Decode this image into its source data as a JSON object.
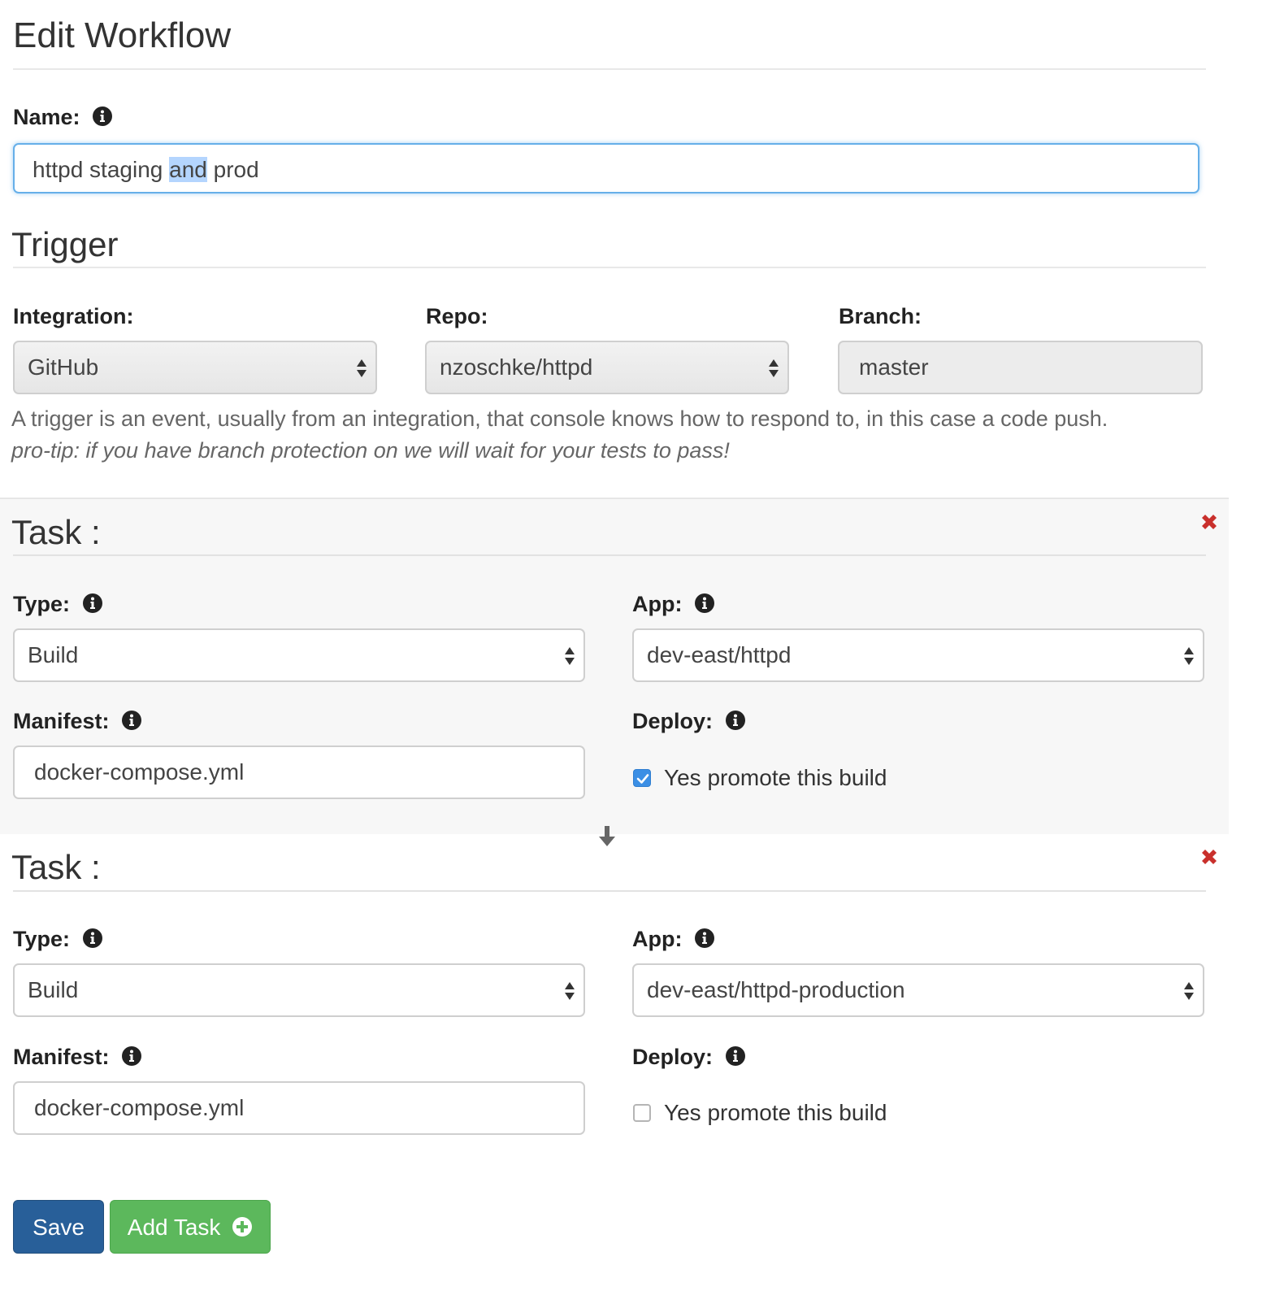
{
  "page": {
    "title": "Edit Workflow"
  },
  "name_field": {
    "label": "Name:",
    "value_before": "httpd staging ",
    "value_selected": "and",
    "value_after": " prod"
  },
  "trigger": {
    "heading": "Trigger",
    "integration": {
      "label": "Integration:",
      "value": "GitHub"
    },
    "repo": {
      "label": "Repo:",
      "value": "nzoschke/httpd"
    },
    "branch": {
      "label": "Branch:",
      "value": "master"
    },
    "help_text": "A trigger is an event, usually from an integration, that console knows how to respond to, in this case a code push.",
    "pro_tip": "pro-tip: if you have branch protection on we will wait for your tests to pass!"
  },
  "tasks": [
    {
      "heading": "Task :",
      "type": {
        "label": "Type:",
        "value": "Build"
      },
      "app": {
        "label": "App:",
        "value": "dev-east/httpd"
      },
      "manifest": {
        "label": "Manifest:",
        "value": "docker-compose.yml"
      },
      "deploy": {
        "label": "Deploy:",
        "checkbox_label": "Yes promote this build",
        "checked": true
      }
    },
    {
      "heading": "Task :",
      "type": {
        "label": "Type:",
        "value": "Build"
      },
      "app": {
        "label": "App:",
        "value": "dev-east/httpd-production"
      },
      "manifest": {
        "label": "Manifest:",
        "value": "docker-compose.yml"
      },
      "deploy": {
        "label": "Deploy:",
        "checkbox_label": "Yes promote this build",
        "checked": false
      }
    }
  ],
  "buttons": {
    "save": "Save",
    "add_task": "Add Task"
  },
  "colors": {
    "primary": "#285f99",
    "success": "#5cb85c",
    "danger": "#c9302c",
    "focus": "#66afe9",
    "checkbox": "#3b8fe5"
  },
  "icons": {
    "info": "info-circle-icon",
    "remove": "remove-x-icon",
    "arrow": "arrow-down-icon",
    "plus": "plus-circle-icon"
  }
}
